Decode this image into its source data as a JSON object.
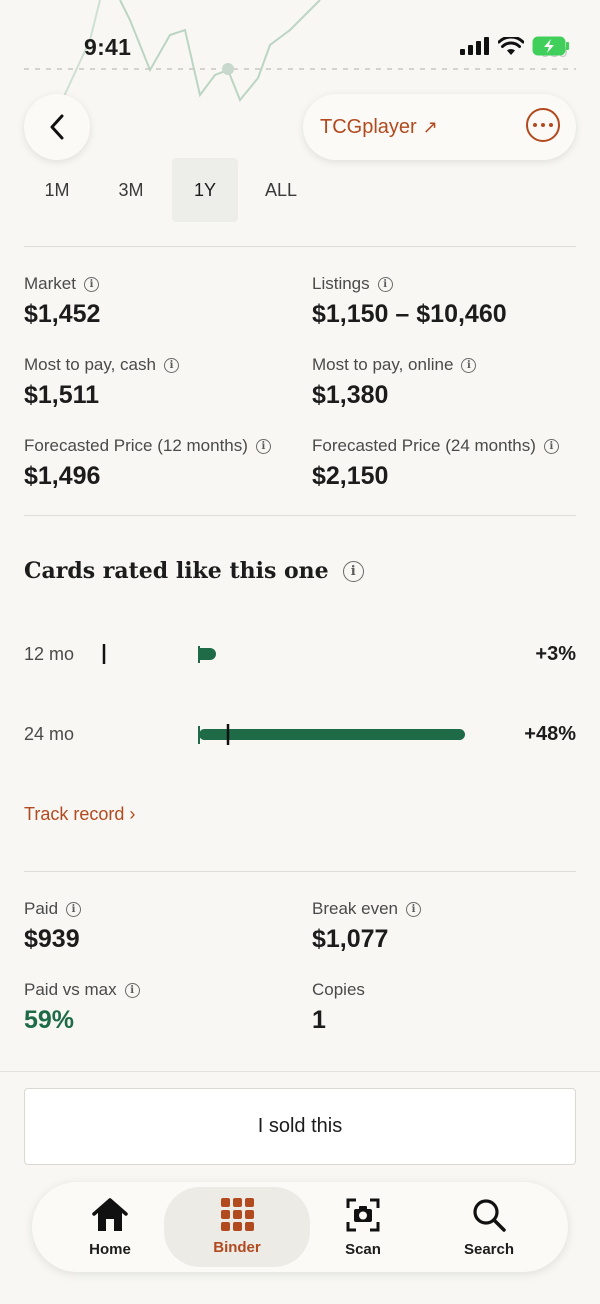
{
  "status_bar": {
    "time": "9:41",
    "ghost_value": "939"
  },
  "nav": {
    "tcg_label": "TCGplayer",
    "tcg_arrow": "↗"
  },
  "range_tabs": [
    {
      "label": "1M",
      "active": false
    },
    {
      "label": "3M",
      "active": false
    },
    {
      "label": "1Y",
      "active": true
    },
    {
      "label": "ALL",
      "active": false
    }
  ],
  "prices": {
    "market": {
      "label": "Market",
      "value": "$1,452"
    },
    "listings": {
      "label": "Listings",
      "value": "$1,150 – $10,460"
    },
    "most_cash": {
      "label": "Most to pay, cash",
      "value": "$1,511"
    },
    "most_online": {
      "label": "Most to pay, online",
      "value": "$1,380"
    },
    "forecast_12": {
      "label": "Forecasted Price (12 months)",
      "value": "$1,496"
    },
    "forecast_24": {
      "label": "Forecasted Price (24 months)",
      "value": "$2,150"
    }
  },
  "rated": {
    "title": "Cards rated like this one",
    "rows": [
      {
        "label": "12 mo",
        "pct": "+3%",
        "value": 3
      },
      {
        "label": "24 mo",
        "pct": "+48%",
        "value": 48
      }
    ],
    "track_record": "Track record ›"
  },
  "holdings": {
    "paid": {
      "label": "Paid",
      "value": "$939"
    },
    "break_even": {
      "label": "Break even",
      "value": "$1,077"
    },
    "paid_vs_max": {
      "label": "Paid vs max",
      "value": "59%"
    },
    "copies": {
      "label": "Copies",
      "value": "1"
    }
  },
  "sold_button": "I sold this",
  "tabbar": [
    {
      "label": "Home",
      "icon": "home-icon"
    },
    {
      "label": "Binder",
      "icon": "grid-icon",
      "active": true
    },
    {
      "label": "Scan",
      "icon": "camera-scan-icon"
    },
    {
      "label": "Search",
      "icon": "search-icon"
    }
  ],
  "colors": {
    "accent": "#b24a1f",
    "green": "#1f6b48",
    "background": "#f8f7f3"
  }
}
